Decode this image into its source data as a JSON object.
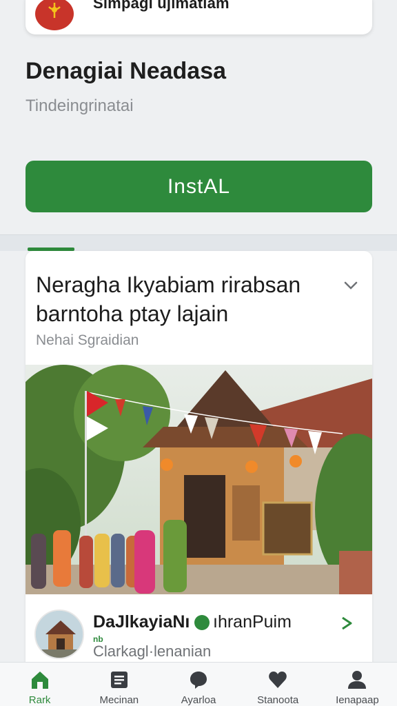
{
  "top_card": {
    "title": "Simpagi ujimatlam"
  },
  "app": {
    "name": "Denagiai Neadasa",
    "subtitle": "Tindeingrinatai",
    "install_label": "InstAL",
    "accent_color": "#2e8a3c"
  },
  "post": {
    "title": "Neragha Ikyabiam rirabsan barntoha ptay lajain",
    "meta": "Nehai Sgraidian",
    "image_icon": "village-festival-photo",
    "author": {
      "name": "DaJlkayiaNı",
      "handle": "ıhranPuim",
      "tag": "nb",
      "location": "Clarkagl·lenanian"
    }
  },
  "bottom_nav": [
    {
      "label": "Rark",
      "icon": "home-icon",
      "active": true
    },
    {
      "label": "Mecinan",
      "icon": "news-icon",
      "active": false
    },
    {
      "label": "Ayarloa",
      "icon": "chat-icon",
      "active": false
    },
    {
      "label": "Stanoota",
      "icon": "heart-icon",
      "active": false
    },
    {
      "label": "Ienapaap",
      "icon": "profile-icon",
      "active": false
    }
  ]
}
